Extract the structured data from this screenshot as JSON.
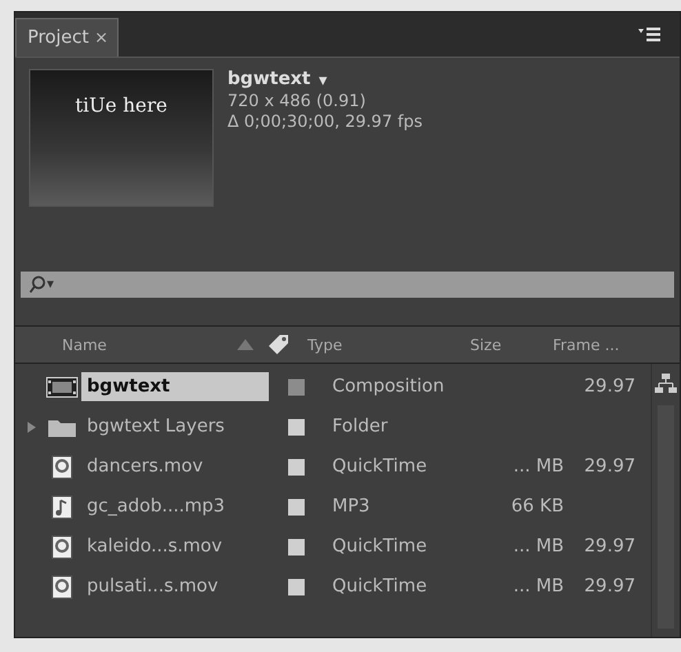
{
  "tab": {
    "label": "Project",
    "close": "×"
  },
  "preview": {
    "thumbnail_text": "tiUe here",
    "name": "bgwtext",
    "caret": "▾",
    "dimensions": "720 x 486 (0.91)",
    "duration": "Δ 0;00;30;00, 29.97 fps"
  },
  "search": {
    "caret": "▾"
  },
  "columns": [
    "Name",
    "Type",
    "Size",
    "Frame ..."
  ],
  "rows": [
    {
      "kind": "composition",
      "name": "bgwtext",
      "selected": true,
      "color": "#8c8c8c",
      "type": "Composition",
      "frame": "29.97"
    },
    {
      "kind": "folder",
      "name": "bgwtext Layers",
      "selected": false,
      "expanded": false,
      "color": "#cfcfcf",
      "type": "Folder"
    },
    {
      "kind": "movie",
      "name": "dancers.mov",
      "selected": false,
      "color": "#cfcfcf",
      "type": "QuickTime",
      "size": "... MB",
      "frame": "29.97"
    },
    {
      "kind": "audio",
      "name": "gc_adob....mp3",
      "selected": false,
      "color": "#cfcfcf",
      "type": "MP3",
      "size": "66 KB"
    },
    {
      "kind": "movie",
      "name": "kaleido...s.mov",
      "selected": false,
      "color": "#cfcfcf",
      "type": "QuickTime",
      "size": "... MB",
      "frame": "29.97"
    },
    {
      "kind": "movie",
      "name": "pulsati...s.mov",
      "selected": false,
      "color": "#cfcfcf",
      "type": "QuickTime",
      "size": "... MB",
      "frame": "29.97"
    }
  ]
}
